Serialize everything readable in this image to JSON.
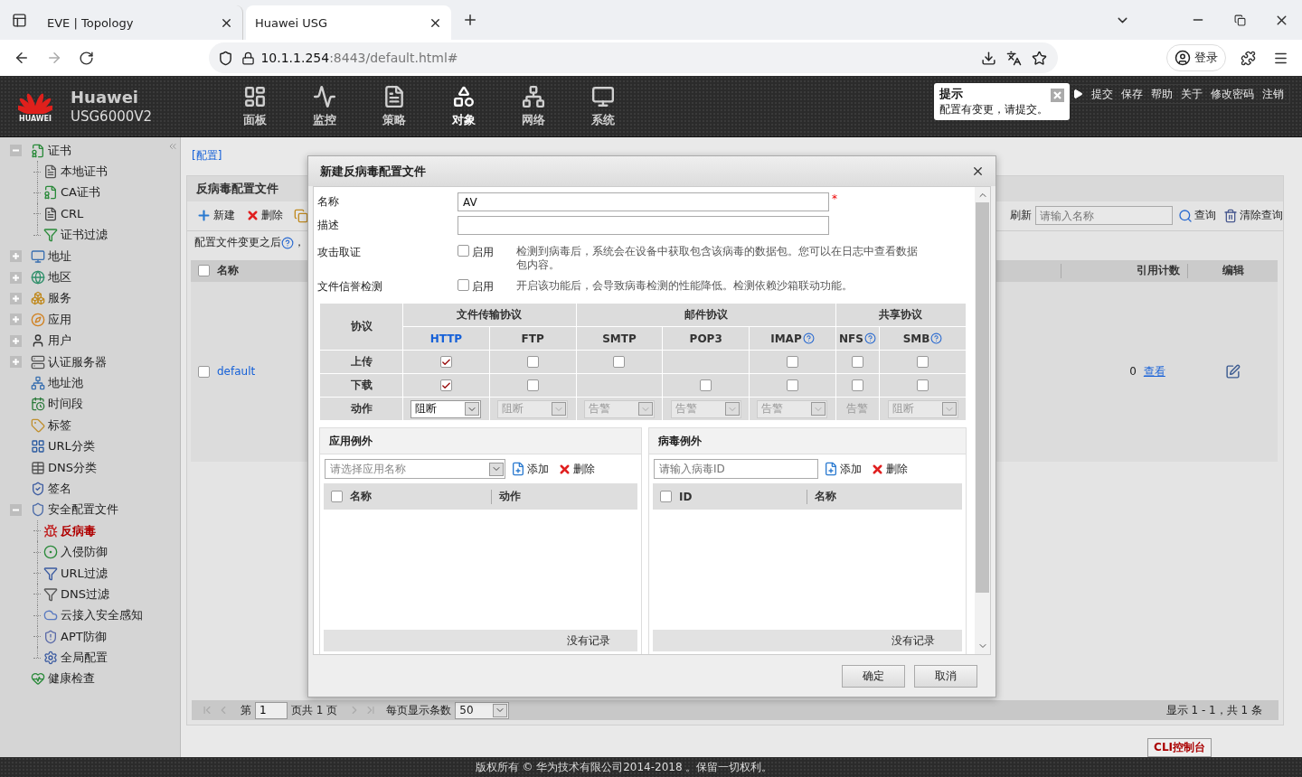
{
  "browser": {
    "tabs": [
      {
        "title": "EVE | Topology",
        "selected": false
      },
      {
        "title": "Huawei USG",
        "selected": true
      }
    ],
    "address": {
      "host": "10.1.1.254",
      "rest": ":8443/default.html#"
    },
    "profile": "登录"
  },
  "header": {
    "logo_text": "HUAWEI",
    "brand": "Huawei",
    "model": "USG6000V2",
    "nav": [
      {
        "label": "面板",
        "selected": false
      },
      {
        "label": "监控",
        "selected": false
      },
      {
        "label": "策略",
        "selected": false
      },
      {
        "label": "对象",
        "selected": true
      },
      {
        "label": "网络",
        "selected": false
      },
      {
        "label": "系统",
        "selected": false
      }
    ],
    "links": [
      "提交",
      "保存",
      "帮助",
      "关于",
      "修改密码",
      "注销"
    ],
    "tip": {
      "title": "提示",
      "message": "配置有变更，请提交。"
    }
  },
  "sidebar": {
    "items": [
      {
        "label": "证书",
        "kind": "group",
        "expanded": true,
        "selected": false,
        "children": [
          {
            "label": "本地证书",
            "selected": false
          },
          {
            "label": "CA证书",
            "selected": false
          },
          {
            "label": "CRL",
            "selected": false
          },
          {
            "label": "证书过滤",
            "selected": false
          }
        ]
      },
      {
        "label": "地址",
        "kind": "group",
        "expanded": false,
        "selected": false
      },
      {
        "label": "地区",
        "kind": "group",
        "expanded": false,
        "selected": false
      },
      {
        "label": "服务",
        "kind": "group",
        "expanded": false,
        "selected": false
      },
      {
        "label": "应用",
        "kind": "group",
        "expanded": false,
        "selected": false
      },
      {
        "label": "用户",
        "kind": "group",
        "expanded": false,
        "selected": false
      },
      {
        "label": "认证服务器",
        "kind": "group",
        "expanded": false,
        "selected": false
      },
      {
        "label": "地址池",
        "kind": "leaf",
        "selected": false
      },
      {
        "label": "时间段",
        "kind": "leaf",
        "selected": false
      },
      {
        "label": "标签",
        "kind": "leaf",
        "selected": false
      },
      {
        "label": "URL分类",
        "kind": "leaf",
        "selected": false
      },
      {
        "label": "DNS分类",
        "kind": "leaf",
        "selected": false
      },
      {
        "label": "签名",
        "kind": "leaf",
        "selected": false
      },
      {
        "label": "安全配置文件",
        "kind": "group",
        "expanded": true,
        "selected": false,
        "children": [
          {
            "label": "反病毒",
            "selected": true
          },
          {
            "label": "入侵防御",
            "selected": false
          },
          {
            "label": "URL过滤",
            "selected": false
          },
          {
            "label": "DNS过滤",
            "selected": false
          },
          {
            "label": "云接入安全感知",
            "selected": false
          },
          {
            "label": "APT防御",
            "selected": false
          },
          {
            "label": "全局配置",
            "selected": false
          }
        ]
      },
      {
        "label": "健康检查",
        "kind": "leaf",
        "selected": false
      }
    ]
  },
  "breadcrumb": "[配置]",
  "panel": {
    "title": "反病毒配置文件",
    "actions": [
      "新建",
      "删除"
    ],
    "note_before": "配置文件变更之后",
    "note_after": "，",
    "refresh": "刷新",
    "search_placeholder": "请输入名称",
    "query": "查询",
    "clear": "清除查询",
    "columns": {
      "name": "名称",
      "count": "引用计数",
      "edit": "编辑",
      "all_checked": false
    },
    "rows": [
      {
        "name": "default",
        "checked": false,
        "count": "0",
        "view": "查看"
      }
    ],
    "pagination": {
      "page_prefix": "第",
      "page": "1",
      "page_suffix": "页共 1 页",
      "per_page_label": "每页显示条数",
      "per_page": "50",
      "summary": "显示 1 - 1，共 1 条"
    },
    "cli": "CLI控制台"
  },
  "dialog": {
    "title": "新建反病毒配置文件",
    "fields": [
      {
        "label": "名称",
        "kind": "input",
        "value": "AV",
        "required_mark": "*"
      },
      {
        "label": "描述",
        "kind": "input"
      },
      {
        "label": "攻击取证",
        "kind": "toggle",
        "option": "启用",
        "checked": false,
        "hint": "检测到病毒后，系统会在设备中获取包含该病毒的数据包。您可以在日志中查看数据包内容。"
      },
      {
        "label": "文件信誉检测",
        "kind": "toggle",
        "option": "启用",
        "checked": false,
        "hint": "开启该功能后，会导致病毒检测的性能降低。检测依赖沙箱联动功能。"
      }
    ],
    "protocols": {
      "corner": "协议",
      "groups": [
        {
          "label": "文件传输协议",
          "protocols": [
            {
              "name": "HTTP",
              "help": false,
              "highlighted": true
            },
            {
              "name": "FTP",
              "help": false,
              "highlighted": false
            }
          ]
        },
        {
          "label": "邮件协议",
          "protocols": [
            {
              "name": "SMTP",
              "help": false,
              "highlighted": false
            },
            {
              "name": "POP3",
              "help": false,
              "highlighted": false
            },
            {
              "name": "IMAP",
              "help": true,
              "highlighted": false
            }
          ]
        },
        {
          "label": "共享协议",
          "protocols": [
            {
              "name": "NFS",
              "help": true,
              "highlighted": false
            },
            {
              "name": "SMB",
              "help": true,
              "highlighted": false
            }
          ]
        }
      ],
      "rows": [
        {
          "label": "上传",
          "cells": [
            {
              "kind": "checkbox",
              "checked": true
            },
            {
              "kind": "checkbox",
              "checked": false
            },
            {
              "kind": "checkbox",
              "checked": false
            },
            {
              "kind": "none"
            },
            {
              "kind": "checkbox",
              "checked": false
            },
            {
              "kind": "checkbox",
              "checked": false
            },
            {
              "kind": "checkbox",
              "checked": false
            }
          ]
        },
        {
          "label": "下载",
          "cells": [
            {
              "kind": "checkbox",
              "checked": true
            },
            {
              "kind": "checkbox",
              "checked": false
            },
            {
              "kind": "none"
            },
            {
              "kind": "checkbox",
              "checked": false
            },
            {
              "kind": "checkbox",
              "checked": false
            },
            {
              "kind": "checkbox",
              "checked": false
            },
            {
              "kind": "checkbox",
              "checked": false
            }
          ]
        },
        {
          "label": "动作",
          "cells": [
            {
              "kind": "select",
              "value": "阻断",
              "disabled": false
            },
            {
              "kind": "select",
              "value": "阻断",
              "disabled": true
            },
            {
              "kind": "select",
              "value": "告警",
              "disabled": true
            },
            {
              "kind": "select",
              "value": "告警",
              "disabled": true
            },
            {
              "kind": "select",
              "value": "告警",
              "disabled": true
            },
            {
              "kind": "text",
              "value": "告警",
              "disabled": true
            },
            {
              "kind": "select",
              "value": "阻断",
              "disabled": true
            }
          ]
        }
      ]
    },
    "exceptions": [
      {
        "title": "应用例外",
        "field": {
          "kind": "select",
          "placeholder": "请选择应用名称"
        },
        "add": "添加",
        "remove": "删除",
        "all_checked": false,
        "columns": [
          "名称",
          "动作"
        ],
        "empty": "没有记录"
      },
      {
        "title": "病毒例外",
        "field": {
          "kind": "input",
          "placeholder": "请输入病毒ID"
        },
        "add": "添加",
        "remove": "删除",
        "all_checked": false,
        "columns": [
          "ID",
          "名称"
        ],
        "empty": "没有记录"
      }
    ],
    "buttons": [
      "确定",
      "取消"
    ]
  },
  "footer": "版权所有 © 华为技术有限公司2014-2018 。保留一切权利。"
}
